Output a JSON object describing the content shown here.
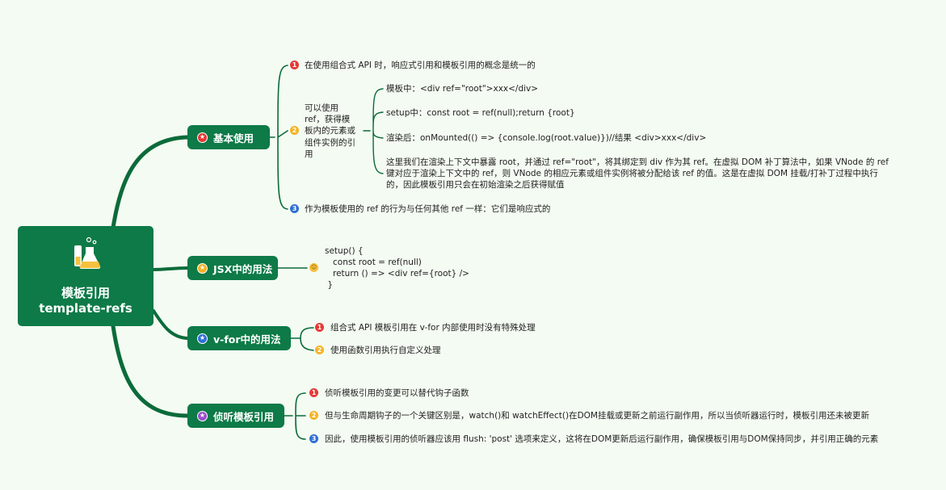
{
  "colors": {
    "node_fill": "#0d7a47",
    "link_stroke": "#0b6b3a",
    "background": "#f4fbf2",
    "marker_red": "#e53935",
    "marker_orange": "#f4b325",
    "marker_blue": "#2f6fd6"
  },
  "root": {
    "icon": "lab-flask-icon",
    "title": "模板引用",
    "subtitle": "template-refs"
  },
  "branches": [
    {
      "label": "基本使用",
      "star_color": "#e53935",
      "children": [
        {
          "marker": "1",
          "text": "在使用组合式 API 时，响应式引用和模板引用的概念是统一的"
        },
        {
          "marker": "2",
          "text_lines": [
            "可以使用",
            "ref，获得模",
            "板内的元素或",
            "组件实例的引",
            "用"
          ],
          "children": [
            {
              "text": "模板中：<div ref=\"root\">xxx</div>"
            },
            {
              "text": "setup中：const root = ref(null);return {root}"
            },
            {
              "text": "渲染后：onMounted(() => {console.log(root.value)})//结果 <div>xxx</div>"
            },
            {
              "text_lines": [
                "这里我们在渲染上下文中暴露 root，并通过 ref=\"root\"，将其绑定到 div 作为其 ref。在虚拟 DOM 补丁算法中，如果 VNode 的 ref",
                "键对应于渲染上下文中的 ref，则 VNode 的相应元素或组件实例将被分配给该 ref 的值。这是在虚拟 DOM 挂载/打补丁过程中执行",
                "的，因此模板引用只会在初始渲染之后获得赋值"
              ]
            }
          ]
        },
        {
          "marker": "3",
          "text": "作为模板使用的 ref 的行为与任何其他 ref 一样：它们是响应式的"
        }
      ]
    },
    {
      "label": "JSX中的用法",
      "star_color": "#f4b325",
      "children": [
        {
          "marker": "smile",
          "code_lines": [
            "setup() {",
            "   const root = ref(null)",
            "   return () => <div ref={root} />",
            " }"
          ]
        }
      ]
    },
    {
      "label": "v-for中的用法",
      "star_color": "#2f6fd6",
      "children": [
        {
          "marker": "1",
          "text": "组合式 API 模板引用在 v-for 内部使用时没有特殊处理"
        },
        {
          "marker": "2",
          "text": "使用函数引用执行自定义处理"
        }
      ]
    },
    {
      "label": "侦听模板引用",
      "star_color": "#9c4dcc",
      "children": [
        {
          "marker": "1",
          "text": "侦听模板引用的变更可以替代钩子函数"
        },
        {
          "marker": "2",
          "text": "但与生命周期钩子的一个关键区别是，watch()和 watchEffect()在DOM挂载或更新之前运行副作用，所以当侦听器运行时，模板引用还未被更新"
        },
        {
          "marker": "3",
          "text": "因此，使用模板引用的侦听器应该用 flush: 'post' 选项来定义，这将在DOM更新后运行副作用，确保模板引用与DOM保持同步，并引用正确的元素"
        }
      ]
    }
  ]
}
